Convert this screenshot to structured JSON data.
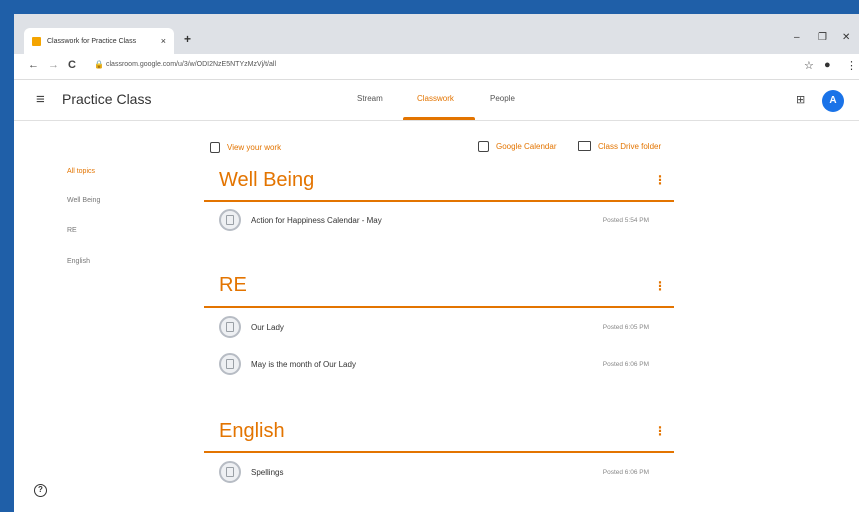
{
  "browser": {
    "tab_title": "Classwork for Practice Class",
    "tab_close": "×",
    "new_tab": "+",
    "window_controls": [
      "–",
      "❐",
      "✕"
    ],
    "url": "classroom.google.com/u/3/w/ODI2NzE5NTYzMzVj/t/all",
    "nav": {
      "back": "←",
      "forward": "→",
      "reload": "C"
    },
    "star": "☆",
    "profile": "●",
    "menu": "⋮"
  },
  "header": {
    "class_name": "Practice Class",
    "tabs": [
      {
        "label": "Stream"
      },
      {
        "label": "Classwork"
      },
      {
        "label": "People"
      }
    ],
    "apps_icon": "⊞",
    "avatar_letter": "A"
  },
  "actions": {
    "view_work": "View your work",
    "google_calendar": "Google Calendar",
    "drive_folder": "Class Drive folder"
  },
  "sidebar": {
    "topics": [
      "All topics",
      "Well Being",
      "RE",
      "English"
    ]
  },
  "sections": [
    {
      "title": "Well Being",
      "more": "⋮",
      "items": [
        {
          "title": "Action for Happiness Calendar - May",
          "date": "Posted 5:54 PM"
        }
      ]
    },
    {
      "title": "RE",
      "more": "⋮",
      "items": [
        {
          "title": "Our Lady",
          "date": "Posted 6:05 PM"
        },
        {
          "title": "May is the month of Our Lady",
          "date": "Posted 6:06 PM"
        }
      ]
    },
    {
      "title": "English",
      "more": "⋮",
      "items": [
        {
          "title": "Spellings",
          "date": "Posted 6:06 PM"
        }
      ]
    }
  ],
  "help": "?"
}
